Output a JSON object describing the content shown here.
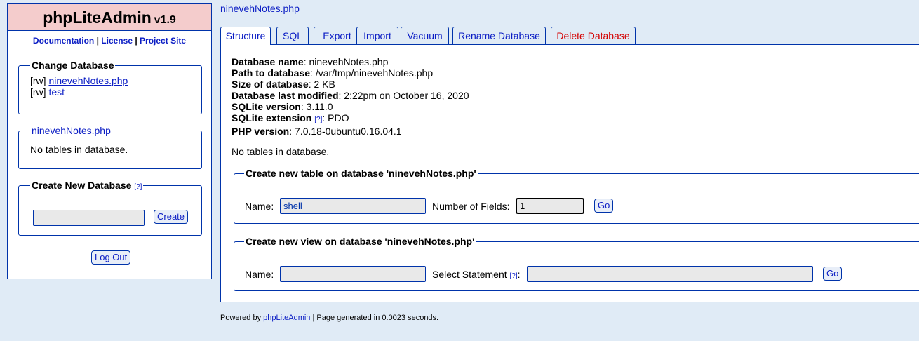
{
  "app": {
    "name": "phpLiteAdmin",
    "version": "v1.9"
  },
  "sidebar": {
    "links": {
      "documentation": "Documentation",
      "license": "License",
      "project_site": "Project Site",
      "separator": "|"
    },
    "change_database": {
      "legend": "Change Database",
      "items": [
        {
          "prefix": "[rw]",
          "name": "ninevehNotes.php"
        },
        {
          "prefix": "[rw]",
          "name": "test"
        }
      ]
    },
    "current_db": {
      "legend": "ninevehNotes.php",
      "message": "No tables in database."
    },
    "create_db": {
      "legend": "Create New Database",
      "help": "[?]",
      "input_value": "",
      "button": "Create"
    },
    "logout": "Log Out"
  },
  "main": {
    "db_title": "ninevehNotes.php",
    "tabs": [
      {
        "label": "Structure",
        "active": true
      },
      {
        "label": "SQL"
      },
      {
        "label": "Export"
      },
      {
        "label": "Import"
      },
      {
        "label": "Vacuum"
      },
      {
        "label": "Rename Database"
      },
      {
        "label": "Delete Database",
        "danger": true
      }
    ],
    "info": {
      "db_name_label": "Database name",
      "db_name": "ninevehNotes.php",
      "path_label": "Path to database",
      "path": "/var/tmp/ninevehNotes.php",
      "size_label": "Size of database",
      "size": "2 KB",
      "modified_label": "Database last modified",
      "modified": "2:22pm on October 16, 2020",
      "sqlite_version_label": "SQLite version",
      "sqlite_version": "3.11.0",
      "sqlite_ext_label": "SQLite extension",
      "sqlite_ext_help": "[?]",
      "sqlite_ext": "PDO",
      "php_version_label": "PHP version",
      "php_version": "7.0.18-0ubuntu0.16.04.1"
    },
    "no_tables": "No tables in database.",
    "create_table": {
      "legend": "Create new table on database 'ninevehNotes.php'",
      "name_label": "Name:",
      "name_value": "shell",
      "fields_label": "Number of Fields:",
      "fields_value": "1",
      "button": "Go"
    },
    "create_view": {
      "legend": "Create new view on database 'ninevehNotes.php'",
      "name_label": "Name:",
      "name_value": "",
      "select_label": "Select Statement",
      "select_help": "[?]",
      "select_colon": ":",
      "select_value": "",
      "button": "Go"
    }
  },
  "footer": {
    "powered_by": "Powered by",
    "link": "phpLiteAdmin",
    "generated": "| Page generated in 0.0023 seconds."
  }
}
